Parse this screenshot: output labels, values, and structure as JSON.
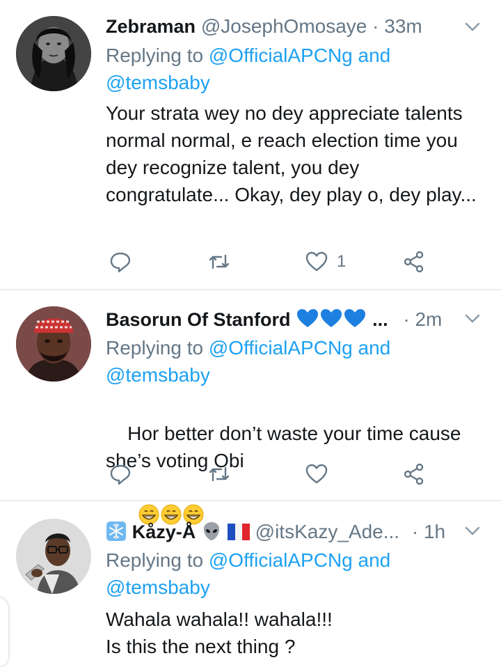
{
  "tweets": [
    {
      "name": "Zebraman",
      "handle": "@JosephOmosaye",
      "dot": "·",
      "time": "33m",
      "replying_prefix": "Replying to",
      "replying_links": [
        "@OfficialAPCNg",
        "and",
        "@temsbaby"
      ],
      "text": "Your strata wey no dey appreciate talents normal normal, e reach election time you dey recognize talent, you dey congratulate... Okay, dey play o, dey play...",
      "likes": "1"
    },
    {
      "name": "Basorun Of Stanford",
      "name_suffix": "...",
      "handle": "",
      "dot": "·",
      "time": "2m",
      "replying_prefix": "Replying to",
      "replying_links": [
        "@OfficialAPCNg",
        "and",
        "@temsbaby"
      ],
      "text": "Hor better don’t waste your time cause she’s voting Obi",
      "likes": ""
    },
    {
      "name": "Kåzy-Å",
      "handle": "@itsKazy_Ade...",
      "dot": "·",
      "time": "1h",
      "replying_prefix": "Replying to",
      "replying_links": [
        "@OfficialAPCNg",
        "and",
        "@temsbaby"
      ],
      "text": "Wahala wahala!! wahala!!!\nIs this the next thing ?"
    }
  ],
  "colors": {
    "link": "#1da1f2",
    "muted": "#657786",
    "heart": "#1d7fe0",
    "divider": "#e6ecf0"
  },
  "icons": [
    "reply-icon",
    "retweet-icon",
    "like-icon",
    "share-icon",
    "chevron-down-icon",
    "snowflake-icon",
    "alien-icon",
    "france-flag-icon",
    "blue-heart-icon",
    "grin-emoji-icon"
  ]
}
